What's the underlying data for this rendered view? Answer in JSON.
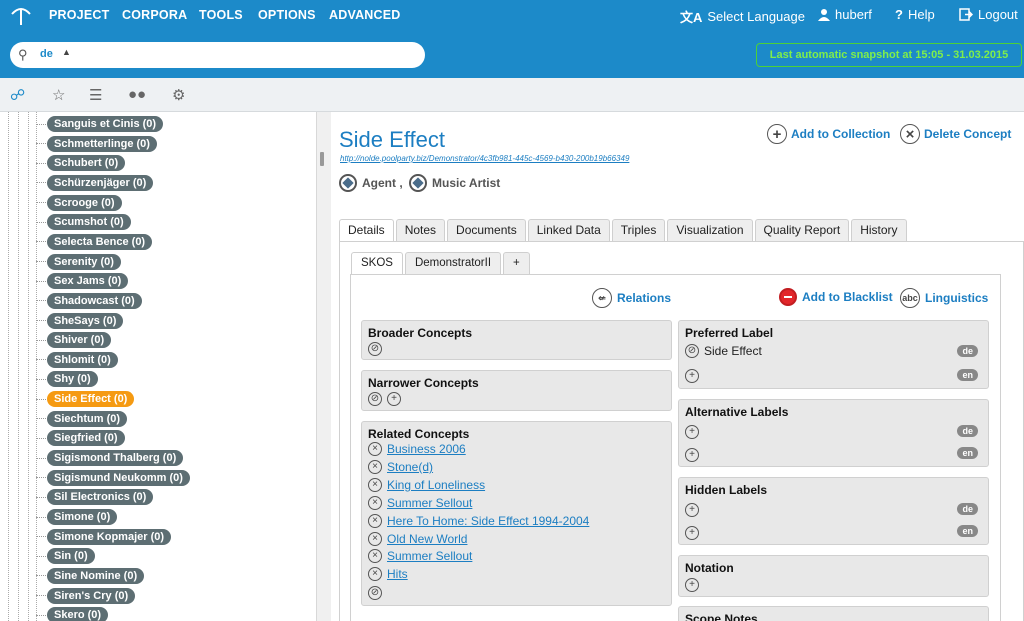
{
  "nav": {
    "project": "PROJECT",
    "corpora": "CORPORA",
    "tools": "TOOLS",
    "options": "OPTIONS",
    "advanced": "ADVANCED",
    "select_language": "Select Language",
    "user": "huberf",
    "help": "Help",
    "logout": "Logout"
  },
  "search": {
    "lang": "de",
    "placeholder": ""
  },
  "snapshot": "Last automatic snapshot at 15:05 - 31.03.2015",
  "tree": [
    "Sanguis et Cinis (0)",
    "Schmetterlinge (0)",
    "Schubert (0)",
    "Schürzenjäger (0)",
    "Scrooge (0)",
    "Scumshot (0)",
    "Selecta Bence (0)",
    "Serenity (0)",
    "Sex Jams (0)",
    "Shadowcast (0)",
    "SheSays (0)",
    "Shiver (0)",
    "Shlomit (0)",
    "Shy (0)",
    "Side Effect (0)",
    "Siechtum (0)",
    "Siegfried (0)",
    "Sigismond Thalberg (0)",
    "Sigismund Neukomm (0)",
    "Sil Electronics (0)",
    "Simone (0)",
    "Simone Kopmajer (0)",
    "Sin (0)",
    "Sine Nomine (0)",
    "Siren's Cry (0)",
    "Skero (0)"
  ],
  "concept": {
    "title": "Side Effect",
    "uri": "http://nolde.poolparty.biz/Demonstrator/4c3fb981-445c-4569-b430-200b19b66349",
    "type1": "Agent ,",
    "type2": "Music Artist",
    "add_collection": "Add to Collection",
    "delete": "Delete Concept"
  },
  "tabs": [
    "Details",
    "Notes",
    "Documents",
    "Linked Data",
    "Triples",
    "Visualization",
    "Quality Report",
    "History"
  ],
  "subtabs": [
    "SKOS",
    "DemonstratorII",
    "+"
  ],
  "actions": {
    "relations": "Relations",
    "blacklist": "Add to Blacklist",
    "linguistics": "Linguistics",
    "abc": "abc"
  },
  "boxes": {
    "broader": "Broader Concepts",
    "narrower": "Narrower Concepts",
    "related": "Related Concepts",
    "preferred": "Preferred Label",
    "alternative": "Alternative Labels",
    "hidden": "Hidden Labels",
    "notation": "Notation",
    "scope": "Scope Notes"
  },
  "related": [
    "Business 2006",
    "Stone(d)",
    "King of Loneliness",
    "Summer Sellout",
    "Here To Home: Side Effect 1994-2004",
    "Old New World",
    "Summer Sellout",
    "Hits"
  ],
  "preferred_value": "Side Effect",
  "lang_de": "de",
  "lang_en": "en"
}
